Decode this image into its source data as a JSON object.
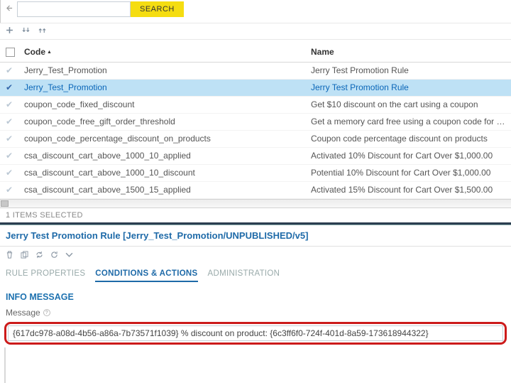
{
  "search": {
    "placeholder": "",
    "button": "SEARCH"
  },
  "columns": {
    "code": "Code",
    "name": "Name"
  },
  "rows": [
    {
      "checked": false,
      "code": "Jerry_Test_Promotion",
      "name": "Jerry Test Promotion Rule",
      "selected": false
    },
    {
      "checked": true,
      "code": "Jerry_Test_Promotion",
      "name": "Jerry Test Promotion Rule",
      "selected": true
    },
    {
      "checked": false,
      "code": "coupon_code_fixed_discount",
      "name": "Get $10 discount on the cart using a coupon",
      "selected": false
    },
    {
      "checked": false,
      "code": "coupon_code_free_gift_order_threshold",
      "name": "Get a memory card free using a coupon code for orders over",
      "selected": false
    },
    {
      "checked": false,
      "code": "coupon_code_percentage_discount_on_products",
      "name": "Coupon code percentage discount on products",
      "selected": false
    },
    {
      "checked": false,
      "code": "csa_discount_cart_above_1000_10_applied",
      "name": "Activated 10% Discount for Cart Over $1,000.00",
      "selected": false
    },
    {
      "checked": false,
      "code": "csa_discount_cart_above_1000_10_discount",
      "name": "Potential 10% Discount for Cart Over $1,000.00",
      "selected": false
    },
    {
      "checked": false,
      "code": "csa_discount_cart_above_1500_15_applied",
      "name": "Activated 15% Discount for Cart Over $1,500.00",
      "selected": false
    }
  ],
  "selection_summary": "1 ITEMS SELECTED",
  "detail": {
    "title": "Jerry Test Promotion Rule [Jerry_Test_Promotion/UNPUBLISHED/v5]",
    "tabs": {
      "rule": "RULE PROPERTIES",
      "cond": "CONDITIONS & ACTIONS",
      "admin": "ADMINISTRATION"
    },
    "section": "INFO MESSAGE",
    "field_label": "Message",
    "message_value": "{617dc978-a08d-4b56-a86a-7b73571f1039} % discount on product: {6c3ff6f0-724f-401d-8a59-173618944322}"
  }
}
